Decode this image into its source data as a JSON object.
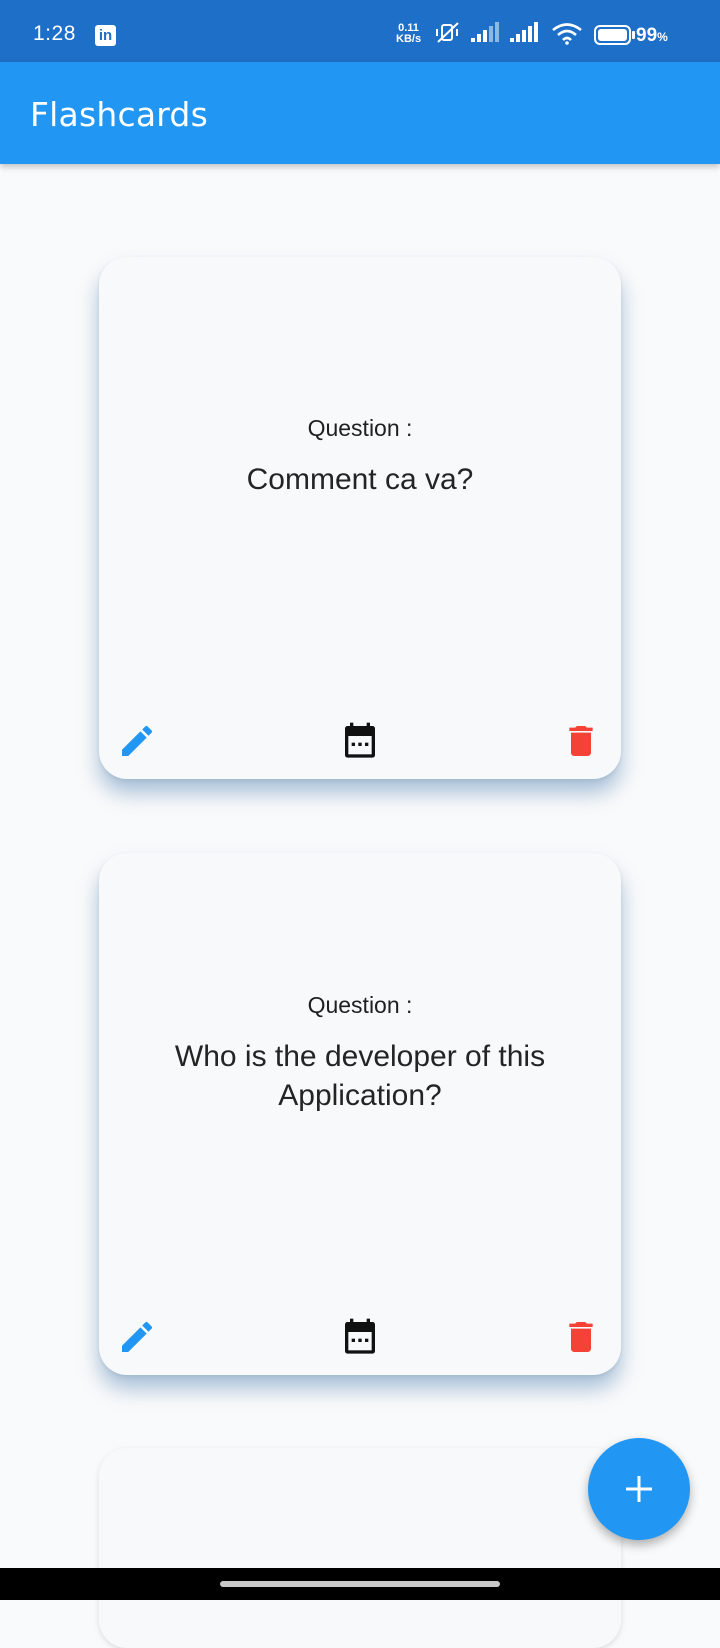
{
  "status_bar": {
    "time": "1:28",
    "net_speed_value": "0.11",
    "net_speed_unit": "KB/s",
    "battery_percent": "99",
    "battery_unit": "%",
    "icons": [
      "linkedin-icon",
      "vibrate-icon",
      "signal-icon",
      "signal-icon",
      "wifi-icon",
      "battery-icon"
    ]
  },
  "app_bar": {
    "title": "Flashcards"
  },
  "cards": [
    {
      "label": "Question :",
      "question": "Comment ca va?"
    },
    {
      "label": "Question :",
      "question": "Who is the developer of this Application?"
    }
  ],
  "card_actions": {
    "edit_icon": "pencil-icon",
    "schedule_icon": "calendar-icon",
    "delete_icon": "trash-icon"
  },
  "fab": {
    "icon": "plus-icon"
  },
  "colors": {
    "status_bar": "#1e6fc7",
    "app_bar": "#2196f3",
    "background": "#f9fafb",
    "card": "#f8f9fa",
    "edit": "#2196f3",
    "delete": "#f44336",
    "calendar": "#111111"
  }
}
